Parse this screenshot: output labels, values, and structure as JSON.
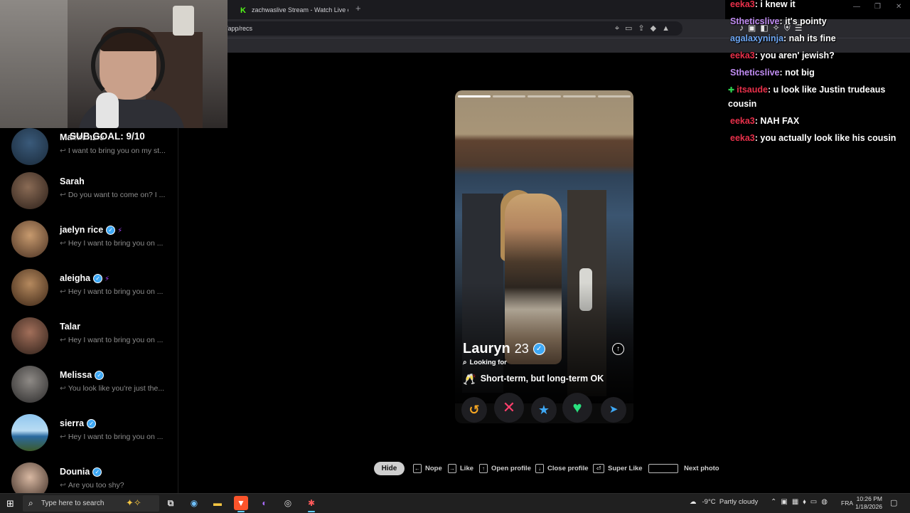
{
  "browser": {
    "tab_title": "zachwaslive Stream - Watch Live on K",
    "new_tab": "+",
    "url": "/app/recs",
    "window_controls": [
      "—",
      "❐",
      "✕"
    ]
  },
  "overlay": {
    "sub_goal": "SUB GOAL: 9/10"
  },
  "matches": [
    {
      "name": "Mackenzie",
      "verified": false,
      "boost": false,
      "message": "I want to bring you on my st..."
    },
    {
      "name": "Sarah",
      "verified": false,
      "boost": false,
      "message": "Do you want to come on? I ..."
    },
    {
      "name": "jaelyn rice",
      "verified": true,
      "boost": true,
      "message": "Hey I want to bring you on ..."
    },
    {
      "name": "aleigha",
      "verified": true,
      "boost": true,
      "message": "Hey I want to bring you on ..."
    },
    {
      "name": "Talar",
      "verified": false,
      "boost": false,
      "message": "Hey I want to bring you on ..."
    },
    {
      "name": "Melissa",
      "verified": true,
      "boost": false,
      "message": "You look like you're just the..."
    },
    {
      "name": "sierra",
      "verified": true,
      "boost": false,
      "message": "Hey I want to bring you on ..."
    },
    {
      "name": "Dounia",
      "verified": true,
      "boost": false,
      "message": "Are you too shy?"
    }
  ],
  "profile": {
    "name": "Lauryn",
    "age": "23",
    "looking_for_label": "Looking for",
    "looking_for_value": "Short-term, but long-term OK",
    "photo_count": 5,
    "current_photo": 1
  },
  "actions": {
    "rewind": "↺",
    "nope": "✕",
    "super_like": "★",
    "like": "♥",
    "boost": "➤"
  },
  "shortcuts": {
    "hide": "Hide",
    "nope": "Nope",
    "like": "Like",
    "open_profile": "Open profile",
    "close_profile": "Close profile",
    "super_like": "Super Like",
    "next_photo": "Next photo"
  },
  "chat": [
    {
      "user": "eeka3",
      "color": "#e8304a",
      "text": ": i knew it"
    },
    {
      "user": "Stheticslive",
      "color": "#c08cf2",
      "text": ": it's pointy"
    },
    {
      "user": "agalaxyninja",
      "color": "#6fa8f5",
      "text": ": nah its fine"
    },
    {
      "user": "eeka3",
      "color": "#e8304a",
      "text": ": you aren' jewish?"
    },
    {
      "user": "Stheticslive",
      "color": "#c08cf2",
      "text": ": not big"
    },
    {
      "user": "itsaude",
      "color": "#e8304a",
      "text": ": u look like Justin trudeaus cousin"
    },
    {
      "user": "eeka3",
      "color": "#e8304a",
      "text": ": NAH FAX"
    },
    {
      "user": "eeka3",
      "color": "#e8304a",
      "text": ": you actually look like his cousin"
    }
  ],
  "taskbar": {
    "search_placeholder": "Type here to search",
    "weather_temp": "-9°C",
    "weather_desc": "Partly cloudy",
    "language": "FRA",
    "time": "10:26 PM",
    "date": "1/18/2026"
  },
  "colors": {
    "verified": "#3ea8f5",
    "boost": "#a13ef5",
    "nope": "#ff3f6c",
    "like": "#29e07e",
    "rewind": "#f5a623",
    "kick_green": "#53fc18"
  }
}
